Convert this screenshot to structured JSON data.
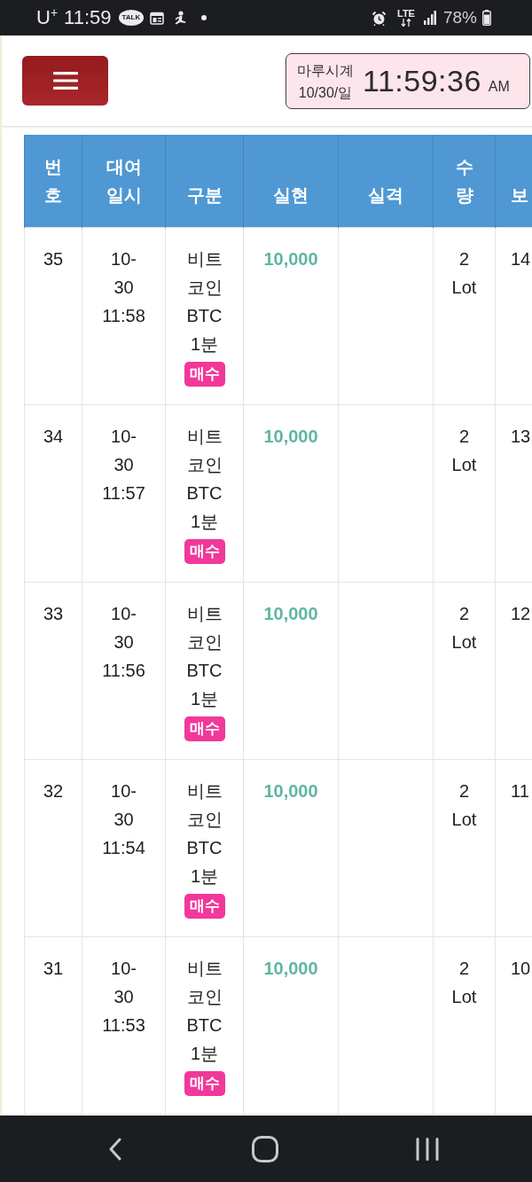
{
  "status_bar": {
    "carrier": "U$^{+}$",
    "time": "11:59",
    "chat_badge": "TALK",
    "network": "LTE",
    "battery": "78%"
  },
  "header": {
    "clock": {
      "title": "마루시계",
      "date": "10/30/일",
      "time": "11:59:36",
      "meridiem": "AM"
    }
  },
  "table": {
    "columns": [
      "번\n호",
      "대여\n일시",
      "구분",
      "실현",
      "실격",
      "수\n량",
      "보"
    ],
    "rows": [
      {
        "number": "35",
        "datetime": "10-\n30\n11:58",
        "type": "비트\n코인\nBTC\n1분",
        "side": "매수",
        "realized": "10,000",
        "quantity": "2\nLot",
        "column_7": "14"
      },
      {
        "number": "34",
        "datetime": "10-\n30\n11:57",
        "type": "비트\n코인\nBTC\n1분",
        "side": "매수",
        "realized": "10,000",
        "quantity": "2\nLot",
        "column_7": "13"
      },
      {
        "number": "33",
        "datetime": "10-\n30\n11:56",
        "type": "비트\n코인\nBTC\n1분",
        "side": "매수",
        "realized": "10,000",
        "quantity": "2\nLot",
        "column_7": "12"
      },
      {
        "number": "32",
        "datetime": "10-\n30\n11:54",
        "type": "비트\n코인\nBTC\n1분",
        "side": "매수",
        "realized": "10,000",
        "quantity": "2\nLot",
        "column_7": "11"
      },
      {
        "number": "31",
        "datetime": "10-\n30\n11:53",
        "type": "비트\n코인\nBTC\n1분",
        "side": "매수",
        "realized": "10,000",
        "quantity": "2\nLot",
        "column_7": "10"
      }
    ]
  }
}
